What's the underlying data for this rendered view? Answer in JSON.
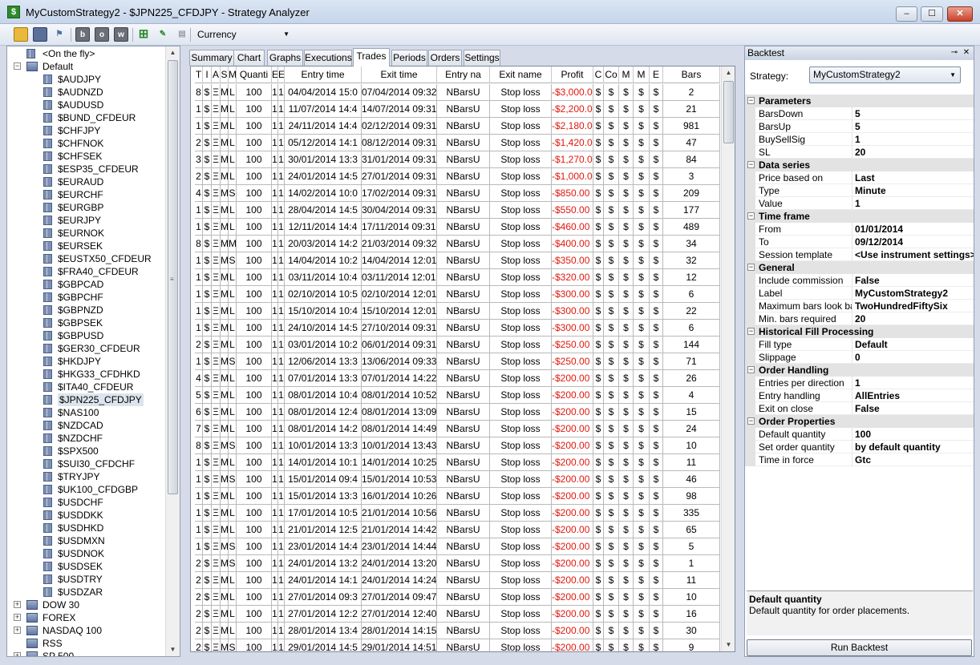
{
  "window": {
    "title": "MyCustomStrategy2 - $JPN225_CFDJPY - Strategy Analyzer"
  },
  "toolbar": {
    "display_mode": "Currency",
    "letter_buttons": [
      "b",
      "o",
      "w"
    ]
  },
  "tree": {
    "items": [
      {
        "label": "<On the fly>",
        "level": 1,
        "type": "leaf"
      },
      {
        "label": "Default",
        "level": 0,
        "type": "folder",
        "expanded": true
      },
      {
        "label": "$AUDJPY",
        "level": 2,
        "type": "leaf"
      },
      {
        "label": "$AUDNZD",
        "level": 2,
        "type": "leaf"
      },
      {
        "label": "$AUDUSD",
        "level": 2,
        "type": "leaf"
      },
      {
        "label": "$BUND_CFDEUR",
        "level": 2,
        "type": "leaf"
      },
      {
        "label": "$CHFJPY",
        "level": 2,
        "type": "leaf"
      },
      {
        "label": "$CHFNOK",
        "level": 2,
        "type": "leaf"
      },
      {
        "label": "$CHFSEK",
        "level": 2,
        "type": "leaf"
      },
      {
        "label": "$ESP35_CFDEUR",
        "level": 2,
        "type": "leaf"
      },
      {
        "label": "$EURAUD",
        "level": 2,
        "type": "leaf"
      },
      {
        "label": "$EURCHF",
        "level": 2,
        "type": "leaf"
      },
      {
        "label": "$EURGBP",
        "level": 2,
        "type": "leaf"
      },
      {
        "label": "$EURJPY",
        "level": 2,
        "type": "leaf"
      },
      {
        "label": "$EURNOK",
        "level": 2,
        "type": "leaf"
      },
      {
        "label": "$EURSEK",
        "level": 2,
        "type": "leaf"
      },
      {
        "label": "$EUSTX50_CFDEUR",
        "level": 2,
        "type": "leaf"
      },
      {
        "label": "$FRA40_CFDEUR",
        "level": 2,
        "type": "leaf"
      },
      {
        "label": "$GBPCAD",
        "level": 2,
        "type": "leaf"
      },
      {
        "label": "$GBPCHF",
        "level": 2,
        "type": "leaf"
      },
      {
        "label": "$GBPNZD",
        "level": 2,
        "type": "leaf"
      },
      {
        "label": "$GBPSEK",
        "level": 2,
        "type": "leaf"
      },
      {
        "label": "$GBPUSD",
        "level": 2,
        "type": "leaf"
      },
      {
        "label": "$GER30_CFDEUR",
        "level": 2,
        "type": "leaf"
      },
      {
        "label": "$HKDJPY",
        "level": 2,
        "type": "leaf"
      },
      {
        "label": "$HKG33_CFDHKD",
        "level": 2,
        "type": "leaf"
      },
      {
        "label": "$ITA40_CFDEUR",
        "level": 2,
        "type": "leaf"
      },
      {
        "label": "$JPN225_CFDJPY",
        "level": 2,
        "type": "leaf",
        "selected": true
      },
      {
        "label": "$NAS100",
        "level": 2,
        "type": "leaf"
      },
      {
        "label": "$NZDCAD",
        "level": 2,
        "type": "leaf"
      },
      {
        "label": "$NZDCHF",
        "level": 2,
        "type": "leaf"
      },
      {
        "label": "$SPX500",
        "level": 2,
        "type": "leaf"
      },
      {
        "label": "$SUI30_CFDCHF",
        "level": 2,
        "type": "leaf"
      },
      {
        "label": "$TRYJPY",
        "level": 2,
        "type": "leaf"
      },
      {
        "label": "$UK100_CFDGBP",
        "level": 2,
        "type": "leaf"
      },
      {
        "label": "$USDCHF",
        "level": 2,
        "type": "leaf"
      },
      {
        "label": "$USDDKK",
        "level": 2,
        "type": "leaf"
      },
      {
        "label": "$USDHKD",
        "level": 2,
        "type": "leaf"
      },
      {
        "label": "$USDMXN",
        "level": 2,
        "type": "leaf"
      },
      {
        "label": "$USDNOK",
        "level": 2,
        "type": "leaf"
      },
      {
        "label": "$USDSEK",
        "level": 2,
        "type": "leaf"
      },
      {
        "label": "$USDTRY",
        "level": 2,
        "type": "leaf"
      },
      {
        "label": "$USDZAR",
        "level": 2,
        "type": "leaf"
      },
      {
        "label": "DOW 30",
        "level": 0,
        "type": "folder",
        "expanded": false
      },
      {
        "label": "FOREX",
        "level": 0,
        "type": "folder",
        "expanded": false
      },
      {
        "label": "NASDAQ 100",
        "level": 0,
        "type": "folder",
        "expanded": false
      },
      {
        "label": "RSS",
        "level": 0,
        "type": "folder",
        "expanded": null
      },
      {
        "label": "SP 500",
        "level": 0,
        "type": "folder",
        "expanded": false
      }
    ]
  },
  "tabs": [
    {
      "label": "Summary",
      "active": false
    },
    {
      "label": "Chart",
      "active": false
    },
    {
      "label": "Graphs",
      "active": false
    },
    {
      "label": "Executions",
      "active": false
    },
    {
      "label": "Trades",
      "active": true
    },
    {
      "label": "Periods",
      "active": false
    },
    {
      "label": "Orders",
      "active": false
    },
    {
      "label": "Settings",
      "active": false
    }
  ],
  "trades": {
    "columns": [
      "T",
      "I",
      "A",
      "S",
      "M",
      "Quanti",
      "E",
      "E",
      "Entry time",
      "Exit time",
      "Entry na",
      "Exit name",
      "Profit",
      "C",
      "Co",
      "M",
      "M",
      "E",
      "Bars"
    ],
    "rows": [
      [
        "8",
        "$",
        "Ξ",
        "M",
        "L",
        "100",
        "1",
        "1",
        "04/04/2014 15:0",
        "07/04/2014 09:32:",
        "NBarsU",
        "Stop loss",
        "-$3,000.0",
        "$",
        "$",
        "$",
        "$",
        "$",
        "2"
      ],
      [
        "1",
        "$",
        "Ξ",
        "M",
        "L",
        "100",
        "1",
        "1",
        "11/07/2014 14:4",
        "14/07/2014 09:31:",
        "NBarsU",
        "Stop loss",
        "-$2,200.0",
        "$",
        "$",
        "$",
        "$",
        "$",
        "21"
      ],
      [
        "1",
        "$",
        "Ξ",
        "M",
        "L",
        "100",
        "1",
        "1",
        "24/11/2014 14:4",
        "02/12/2014 09:31:",
        "NBarsU",
        "Stop loss",
        "-$2,180.0",
        "$",
        "$",
        "$",
        "$",
        "$",
        "981"
      ],
      [
        "2",
        "$",
        "Ξ",
        "M",
        "L",
        "100",
        "1",
        "1",
        "05/12/2014 14:1",
        "08/12/2014 09:31:",
        "NBarsU",
        "Stop loss",
        "-$1,420.0",
        "$",
        "$",
        "$",
        "$",
        "$",
        "47"
      ],
      [
        "3",
        "$",
        "Ξ",
        "M",
        "L",
        "100",
        "1",
        "1",
        "30/01/2014 13:3",
        "31/01/2014 09:31:",
        "NBarsU",
        "Stop loss",
        "-$1,270.0",
        "$",
        "$",
        "$",
        "$",
        "$",
        "84"
      ],
      [
        "2",
        "$",
        "Ξ",
        "M",
        "L",
        "100",
        "1",
        "1",
        "24/01/2014 14:5",
        "27/01/2014 09:31:",
        "NBarsU",
        "Stop loss",
        "-$1,000.0",
        "$",
        "$",
        "$",
        "$",
        "$",
        "3"
      ],
      [
        "4",
        "$",
        "Ξ",
        "M",
        "S",
        "100",
        "1",
        "1",
        "14/02/2014 10:0",
        "17/02/2014 09:31:",
        "NBarsU",
        "Stop loss",
        "-$850.00",
        "$",
        "$",
        "$",
        "$",
        "$",
        "209"
      ],
      [
        "1",
        "$",
        "Ξ",
        "M",
        "L",
        "100",
        "1",
        "1",
        "28/04/2014 14:5",
        "30/04/2014 09:31:",
        "NBarsU",
        "Stop loss",
        "-$550.00",
        "$",
        "$",
        "$",
        "$",
        "$",
        "177"
      ],
      [
        "1",
        "$",
        "Ξ",
        "M",
        "L",
        "100",
        "1",
        "1",
        "12/11/2014 14:4",
        "17/11/2014 09:31:",
        "NBarsU",
        "Stop loss",
        "-$460.00",
        "$",
        "$",
        "$",
        "$",
        "$",
        "489"
      ],
      [
        "8",
        "$",
        "Ξ",
        "M",
        "M",
        "100",
        "1",
        "1",
        "20/03/2014 14:2",
        "21/03/2014 09:32:",
        "NBarsU",
        "Stop loss",
        "-$400.00",
        "$",
        "$",
        "$",
        "$",
        "$",
        "34"
      ],
      [
        "1",
        "$",
        "Ξ",
        "M",
        "S",
        "100",
        "1",
        "1",
        "14/04/2014 10:2",
        "14/04/2014 12:01:",
        "NBarsU",
        "Stop loss",
        "-$350.00",
        "$",
        "$",
        "$",
        "$",
        "$",
        "32"
      ],
      [
        "1",
        "$",
        "Ξ",
        "M",
        "L",
        "100",
        "1",
        "1",
        "03/11/2014 10:4",
        "03/11/2014 12:01:",
        "NBarsU",
        "Stop loss",
        "-$320.00",
        "$",
        "$",
        "$",
        "$",
        "$",
        "12"
      ],
      [
        "1",
        "$",
        "Ξ",
        "M",
        "L",
        "100",
        "1",
        "1",
        "02/10/2014 10:5",
        "02/10/2014 12:01:",
        "NBarsU",
        "Stop loss",
        "-$300.00",
        "$",
        "$",
        "$",
        "$",
        "$",
        "6"
      ],
      [
        "1",
        "$",
        "Ξ",
        "M",
        "L",
        "100",
        "1",
        "1",
        "15/10/2014 10:4",
        "15/10/2014 12:01:",
        "NBarsU",
        "Stop loss",
        "-$300.00",
        "$",
        "$",
        "$",
        "$",
        "$",
        "22"
      ],
      [
        "1",
        "$",
        "Ξ",
        "M",
        "L",
        "100",
        "1",
        "1",
        "24/10/2014 14:5",
        "27/10/2014 09:31:",
        "NBarsU",
        "Stop loss",
        "-$300.00",
        "$",
        "$",
        "$",
        "$",
        "$",
        "6"
      ],
      [
        "2",
        "$",
        "Ξ",
        "M",
        "L",
        "100",
        "1",
        "1",
        "03/01/2014 10:2",
        "06/01/2014 09:31:",
        "NBarsU",
        "Stop loss",
        "-$250.00",
        "$",
        "$",
        "$",
        "$",
        "$",
        "144"
      ],
      [
        "1",
        "$",
        "Ξ",
        "M",
        "S",
        "100",
        "1",
        "1",
        "12/06/2014 13:3",
        "13/06/2014 09:33:",
        "NBarsU",
        "Stop loss",
        "-$250.00",
        "$",
        "$",
        "$",
        "$",
        "$",
        "71"
      ],
      [
        "4",
        "$",
        "Ξ",
        "M",
        "L",
        "100",
        "1",
        "1",
        "07/01/2014 13:3",
        "07/01/2014 14:22:",
        "NBarsU",
        "Stop loss",
        "-$200.00",
        "$",
        "$",
        "$",
        "$",
        "$",
        "26"
      ],
      [
        "5",
        "$",
        "Ξ",
        "M",
        "L",
        "100",
        "1",
        "1",
        "08/01/2014 10:4",
        "08/01/2014 10:52:",
        "NBarsU",
        "Stop loss",
        "-$200.00",
        "$",
        "$",
        "$",
        "$",
        "$",
        "4"
      ],
      [
        "6",
        "$",
        "Ξ",
        "M",
        "L",
        "100",
        "1",
        "1",
        "08/01/2014 12:4",
        "08/01/2014 13:09:",
        "NBarsU",
        "Stop loss",
        "-$200.00",
        "$",
        "$",
        "$",
        "$",
        "$",
        "15"
      ],
      [
        "7",
        "$",
        "Ξ",
        "M",
        "L",
        "100",
        "1",
        "1",
        "08/01/2014 14:2",
        "08/01/2014 14:49:",
        "NBarsU",
        "Stop loss",
        "-$200.00",
        "$",
        "$",
        "$",
        "$",
        "$",
        "24"
      ],
      [
        "8",
        "$",
        "Ξ",
        "M",
        "S",
        "100",
        "1",
        "1",
        "10/01/2014 13:3",
        "10/01/2014 13:43:",
        "NBarsU",
        "Stop loss",
        "-$200.00",
        "$",
        "$",
        "$",
        "$",
        "$",
        "10"
      ],
      [
        "1",
        "$",
        "Ξ",
        "M",
        "L",
        "100",
        "1",
        "1",
        "14/01/2014 10:1",
        "14/01/2014 10:25:",
        "NBarsU",
        "Stop loss",
        "-$200.00",
        "$",
        "$",
        "$",
        "$",
        "$",
        "11"
      ],
      [
        "1",
        "$",
        "Ξ",
        "M",
        "S",
        "100",
        "1",
        "1",
        "15/01/2014 09:4",
        "15/01/2014 10:53:",
        "NBarsU",
        "Stop loss",
        "-$200.00",
        "$",
        "$",
        "$",
        "$",
        "$",
        "46"
      ],
      [
        "1",
        "$",
        "Ξ",
        "M",
        "L",
        "100",
        "1",
        "1",
        "15/01/2014 13:3",
        "16/01/2014 10:26:",
        "NBarsU",
        "Stop loss",
        "-$200.00",
        "$",
        "$",
        "$",
        "$",
        "$",
        "98"
      ],
      [
        "1",
        "$",
        "Ξ",
        "M",
        "L",
        "100",
        "1",
        "1",
        "17/01/2014 10:5",
        "21/01/2014 10:56:",
        "NBarsU",
        "Stop loss",
        "-$200.00",
        "$",
        "$",
        "$",
        "$",
        "$",
        "335"
      ],
      [
        "1",
        "$",
        "Ξ",
        "M",
        "L",
        "100",
        "1",
        "1",
        "21/01/2014 12:5",
        "21/01/2014 14:42:",
        "NBarsU",
        "Stop loss",
        "-$200.00",
        "$",
        "$",
        "$",
        "$",
        "$",
        "65"
      ],
      [
        "1",
        "$",
        "Ξ",
        "M",
        "S",
        "100",
        "1",
        "1",
        "23/01/2014 14:4",
        "23/01/2014 14:44:",
        "NBarsU",
        "Stop loss",
        "-$200.00",
        "$",
        "$",
        "$",
        "$",
        "$",
        "5"
      ],
      [
        "2",
        "$",
        "Ξ",
        "M",
        "S",
        "100",
        "1",
        "1",
        "24/01/2014 13:2",
        "24/01/2014 13:20:",
        "NBarsU",
        "Stop loss",
        "-$200.00",
        "$",
        "$",
        "$",
        "$",
        "$",
        "1"
      ],
      [
        "2",
        "$",
        "Ξ",
        "M",
        "L",
        "100",
        "1",
        "1",
        "24/01/2014 14:1",
        "24/01/2014 14:24:",
        "NBarsU",
        "Stop loss",
        "-$200.00",
        "$",
        "$",
        "$",
        "$",
        "$",
        "11"
      ],
      [
        "2",
        "$",
        "Ξ",
        "M",
        "L",
        "100",
        "1",
        "1",
        "27/01/2014 09:3",
        "27/01/2014 09:47:",
        "NBarsU",
        "Stop loss",
        "-$200.00",
        "$",
        "$",
        "$",
        "$",
        "$",
        "10"
      ],
      [
        "2",
        "$",
        "Ξ",
        "M",
        "L",
        "100",
        "1",
        "1",
        "27/01/2014 12:2",
        "27/01/2014 12:40:",
        "NBarsU",
        "Stop loss",
        "-$200.00",
        "$",
        "$",
        "$",
        "$",
        "$",
        "16"
      ],
      [
        "2",
        "$",
        "Ξ",
        "M",
        "L",
        "100",
        "1",
        "1",
        "28/01/2014 13:4",
        "28/01/2014 14:15:",
        "NBarsU",
        "Stop loss",
        "-$200.00",
        "$",
        "$",
        "$",
        "$",
        "$",
        "30"
      ],
      [
        "2",
        "$",
        "Ξ",
        "M",
        "S",
        "100",
        "1",
        "1",
        "29/01/2014 14:5",
        "29/01/2014 14:51:",
        "NBarsU",
        "Stop loss",
        "-$200.00",
        "$",
        "$",
        "$",
        "$",
        "$",
        "9"
      ]
    ]
  },
  "backtest": {
    "panel_title": "Backtest",
    "strategy_label": "Strategy:",
    "strategy_value": "MyCustomStrategy2",
    "categories": [
      {
        "name": "Parameters",
        "props": [
          [
            "BarsDown",
            "5"
          ],
          [
            "BarsUp",
            "5"
          ],
          [
            "BuySellSig",
            "1"
          ],
          [
            "SL",
            "20"
          ]
        ]
      },
      {
        "name": "Data series",
        "props": [
          [
            "Price based on",
            "Last"
          ],
          [
            "Type",
            "Minute"
          ],
          [
            "Value",
            "1"
          ]
        ]
      },
      {
        "name": "Time frame",
        "props": [
          [
            "From",
            "01/01/2014"
          ],
          [
            "To",
            "09/12/2014"
          ],
          [
            "Session template",
            "<Use instrument settings>"
          ]
        ]
      },
      {
        "name": "General",
        "props": [
          [
            "Include commission",
            "False"
          ],
          [
            "Label",
            "MyCustomStrategy2"
          ],
          [
            "Maximum bars look bac",
            "TwoHundredFiftySix"
          ],
          [
            "Min. bars required",
            "20"
          ]
        ]
      },
      {
        "name": "Historical Fill Processing",
        "props": [
          [
            "Fill type",
            "Default"
          ],
          [
            "Slippage",
            "0"
          ]
        ]
      },
      {
        "name": "Order Handling",
        "props": [
          [
            "Entries per direction",
            "1"
          ],
          [
            "Entry handling",
            "AllEntries"
          ],
          [
            "Exit on close",
            "False"
          ]
        ]
      },
      {
        "name": "Order Properties",
        "props": [
          [
            "Default quantity",
            "100"
          ],
          [
            "Set order quantity",
            "by default quantity"
          ],
          [
            "Time in force",
            "Gtc"
          ]
        ]
      }
    ],
    "description_title": "Default quantity",
    "description_text": "Default quantity for order placements.",
    "run_button": "Run Backtest"
  },
  "colors": {
    "negative_profit": "#e0190f",
    "category_bg": "#e3e3e3",
    "selection": "#dde4ee"
  }
}
